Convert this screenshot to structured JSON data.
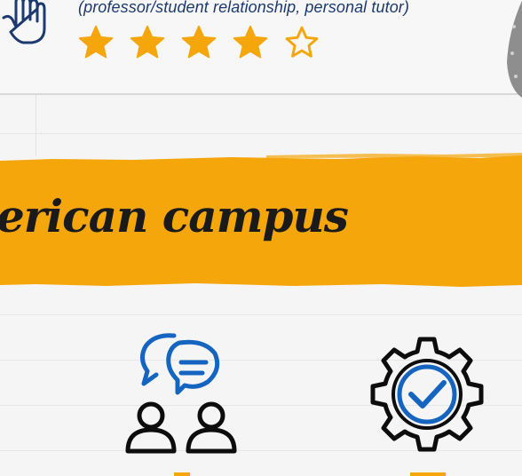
{
  "review": {
    "text": "(professor/student relationship, personal tutor)",
    "rating": 4,
    "max_rating": 5,
    "star_color": "#f5a60b"
  },
  "banner": {
    "title": "erican campus",
    "color": "#f5a60b"
  },
  "icons": [
    "hand-icon",
    "star-icon",
    "people-chat-icon",
    "gear-check-icon"
  ],
  "colors": {
    "accent": "#f5a60b",
    "navy": "#1d3a6e",
    "blue": "#1565c0"
  }
}
